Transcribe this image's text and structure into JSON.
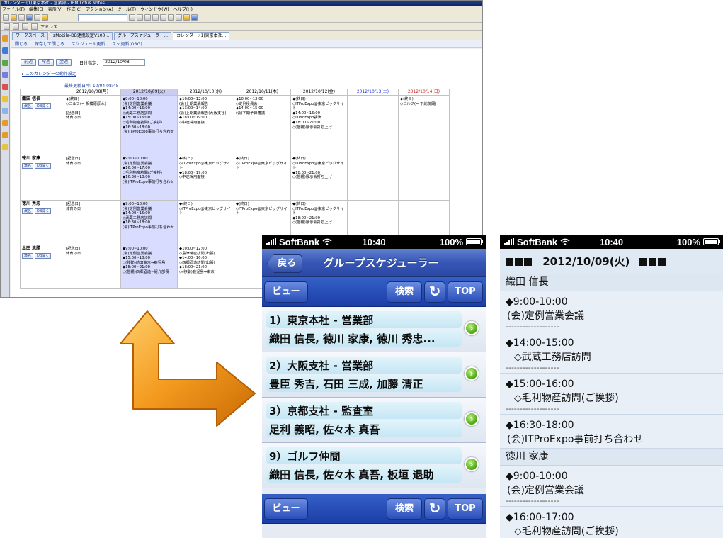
{
  "notes_window": {
    "title": "カレンダー:(1)東京本社 - 営業部 - IBM Lotus Notes",
    "menu": [
      "ファイル(F)",
      "編集(E)",
      "表示(V)",
      "作成(C)",
      "アクション(A)",
      "ツール(T)",
      "ウィンドウ(W)",
      "ヘルプ(H)"
    ],
    "address_label": "アドレス",
    "tabs": [
      "ワークスペース",
      "zMobile-DB連携設定V100...",
      "グループスケジューラー...",
      "カレンダー:(1)東京本社..."
    ],
    "actions": [
      "閉じる",
      "保存して閉じる",
      "スケジュール更新",
      "スケ更新(ORG)"
    ],
    "nav": {
      "prev": "前週",
      "today": "今週",
      "next": "翌週",
      "date_label": "日付指定：",
      "date_value": "2012/10/08"
    },
    "settings_link": "このカレンダーの動作設定",
    "updated": "最終更新日時: 10/04 08:45",
    "days": [
      "2012/10/08(月)",
      "2012/10/09(火)",
      "2012/10/10(水)",
      "2012/10/11(木)",
      "2012/10/12(金)",
      "2012/10/13(土)",
      "2012/10/14(日)"
    ],
    "person_buttons": {
      "mail": "演名",
      "open": "DB開く"
    },
    "rows": [
      {
        "name": "織田 信長",
        "cells": [
          "◆(終日)\n◇ゴルフ(= 相模原厚木)\n\n[記念日]\n体育の日",
          "◆9:00~10:00\n(会)定例営業会議\n◆14:00~15:00\n◇武蔵工務店訪問\n◆15:00~16:00\n◇毛利物産訪問(ご挨拶)\n◆16:30~18:00\n(会)ITProExpo事前打ち合わせ",
          "◆10:00~12:00\n(会)上期業績報告\n◆13:00~14:00\n(会)上期業績報告(大阪支社)\n◆18:00~19:00\n◇中途採用面接",
          "◆10:00~12:00\n◇定例役員会\n◆14:00~15:00\n(会)下期予算審議",
          "◆(終日)\n◇ITProExpo@東京ビッグサイト\n◆14:00~15:00\n◇ITProExpo講演\n◆18:00~21:00\n◇(懇親)展示会打ち上げ",
          "",
          "◆(終日)\n◇ゴルフ(= 下総御厩)"
        ]
      },
      {
        "name": "徳川 家康",
        "cells": [
          "[記念日]\n体育の日",
          "◆9:00~10:00\n(会)定例営業会議\n◆16:00~17:00\n◇毛利物産訪問(ご挨拶)\n◆16:30~18:00\n(会)ITProExpo事前打ち合わせ",
          "◆(終日)\n◇ITProExpo@東京ビッグサイト\n◆18:00~19:00\n◇中途採用面接",
          "◆(終日)\n◇ITProExpo@東京ビッグサイト",
          "◆(終日)\n◇ITProExpo@東京ビッグサイト\n◆18:00~21:00\n◇(懇親)展示会打ち上げ",
          "",
          ""
        ]
      },
      {
        "name": "徳川 秀忠",
        "cells": [
          "[記念日]\n体育の日",
          "◆9:00~10:00\n(会)定例営業会議\n◆14:00~15:00\n◇武蔵工務店訪問\n◆16:30~18:00\n(会)ITProExpo事前打ち合わせ",
          "◆(終日)\n◇ITProExpo@東京ビッグサイト",
          "◆(終日)\n◇ITProExpo@東京ビッグサイト",
          "◆(終日)\n◇ITProExpo@東京ビッグサイト\n◆18:00~21:00\n◇(懇親)展示会打ち上げ",
          "",
          ""
        ]
      },
      {
        "name": "本田 忠勝",
        "cells": [
          "[記念日]\n体育の日",
          "◆9:00~10:00\n(会)定例営業会議\n◆15:00~18:00\n◇(移動)前田東京→鹿児島\n◆18:00~21:00\n◇(懇親)西郷酒造~紹介部長",
          "◆10:00~12:00\n◇島津精密訪問(出張)\n◆14:00~16:00\n◇西郷酒造訪問(出張)\n◆18:00~21:00\n◇(移動)鹿児島→東京",
          "",
          "",
          "",
          ""
        ]
      }
    ]
  },
  "phone1": {
    "status": {
      "carrier": "SoftBank",
      "time": "10:40",
      "battery": "100%"
    },
    "back_label": "戻る",
    "title": "グループスケジューラー",
    "toolbar": {
      "view": "ビュー",
      "search": "検索",
      "refresh": "↻",
      "top": "TOP"
    },
    "groups": [
      {
        "title": "1）東京本社 - 営業部",
        "members": "織田 信長, 徳川 家康, 徳川 秀忠..."
      },
      {
        "title": "2）大阪支社 - 営業部",
        "members": "豊臣 秀吉, 石田 三成, 加藤 清正"
      },
      {
        "title": "3）京都支社 - 監査室",
        "members": "足利 義昭, 佐々木 真吾"
      },
      {
        "title": "9）ゴルフ仲間",
        "members": "織田 信長, 佐々木 真吾, 板垣 退助"
      }
    ]
  },
  "phone2": {
    "status": {
      "carrier": "SoftBank",
      "time": "10:40",
      "battery": "100%"
    },
    "header_date": "2012/10/09(火)",
    "sections": [
      {
        "person": "織田 信長",
        "events": [
          {
            "time": "◆9:00-10:00",
            "desc": "(会)定例営業会議"
          },
          {
            "time": "◆14:00-15:00",
            "desc": "◇武蔵工務店訪問"
          },
          {
            "time": "◆15:00-16:00",
            "desc": "◇毛利物産訪問(ご挨拶)"
          },
          {
            "time": "◆16:30-18:00",
            "desc": "(会)ITProExpo事前打ち合わせ"
          }
        ]
      },
      {
        "person": "徳川 家康",
        "events": [
          {
            "time": "◆9:00-10:00",
            "desc": "(会)定例営業会議"
          },
          {
            "time": "◆16:00-17:00",
            "desc": "◇毛利物産訪問(ご挨拶)"
          }
        ]
      }
    ],
    "separator": "-------------------"
  },
  "colors": {
    "arrow": "#f39a1e",
    "ios_blue": "#2a48a6",
    "selected_day": "#d8dcff",
    "go_button": "#4aa510"
  }
}
